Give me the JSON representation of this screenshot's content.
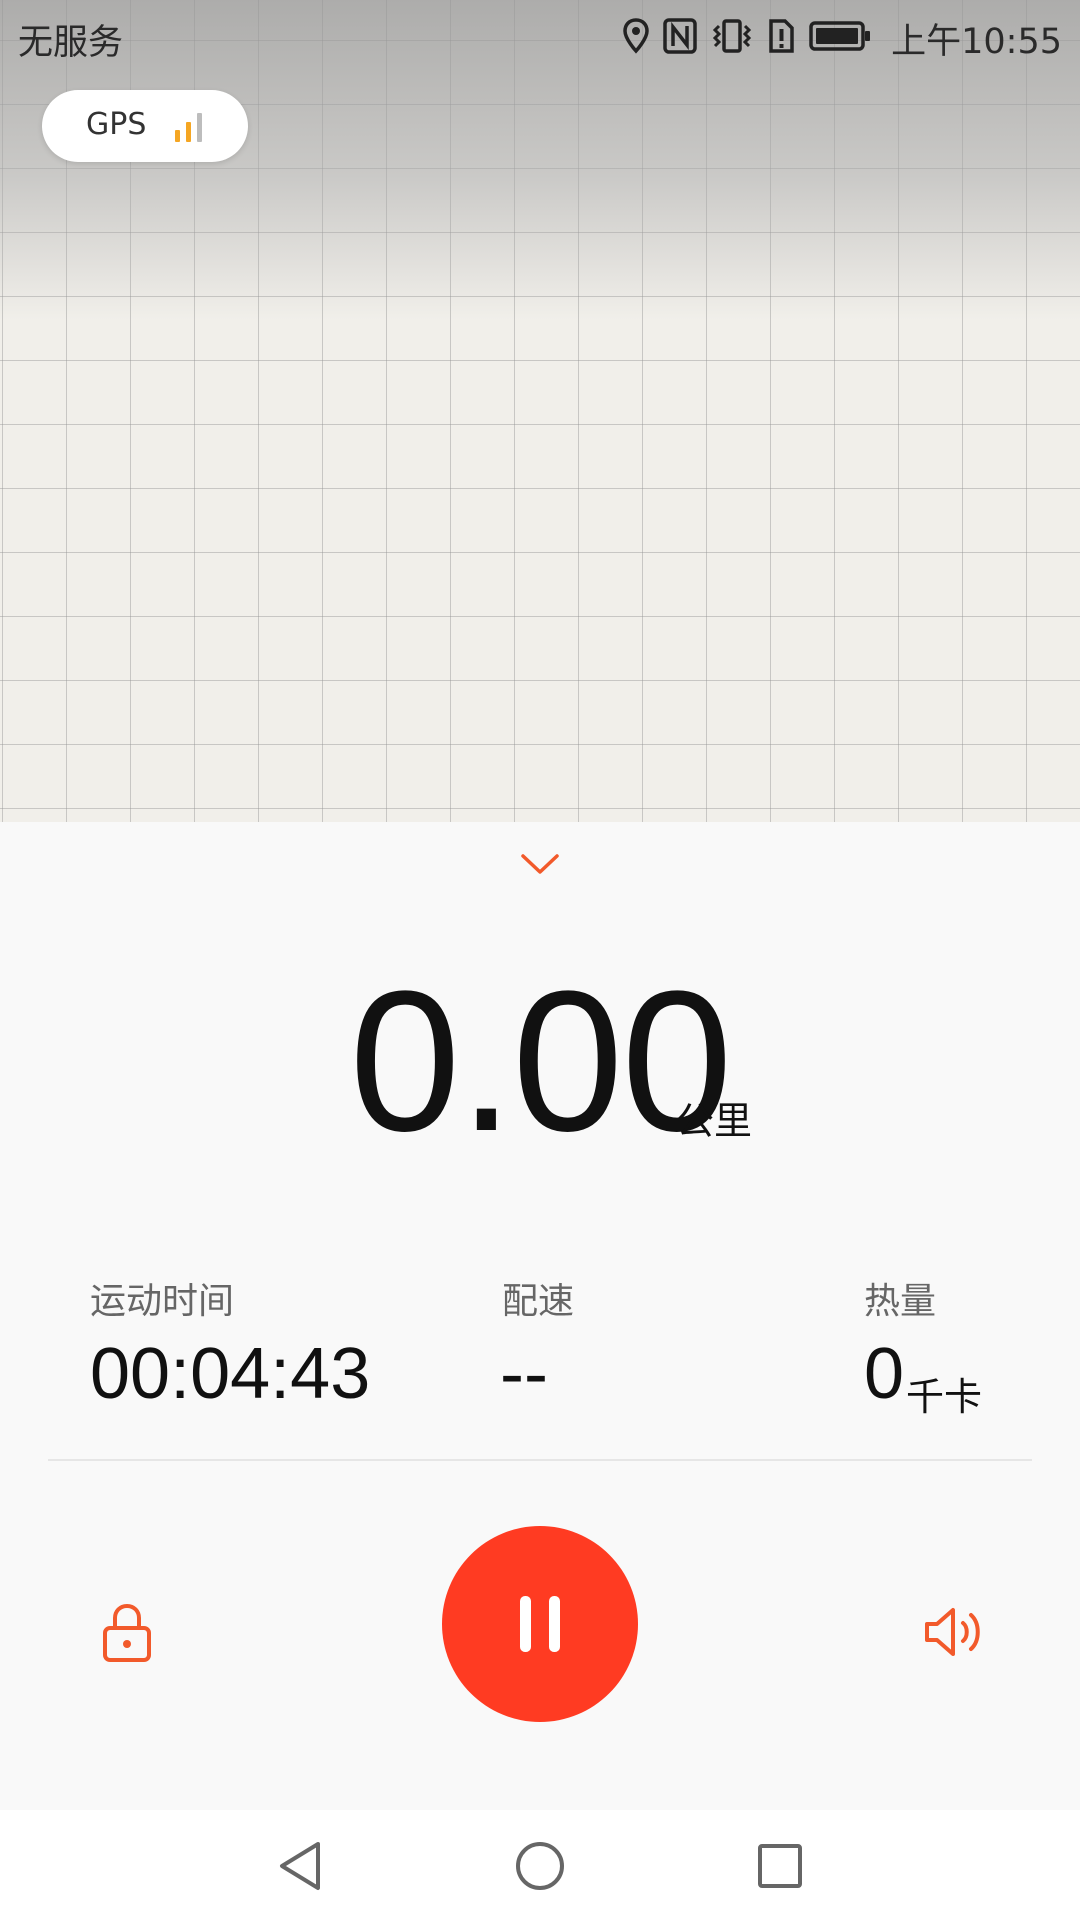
{
  "status_bar": {
    "carrier": "无服务",
    "time": "上午10:55",
    "icons": [
      "location-icon",
      "nfc-icon",
      "vibrate-icon",
      "sim-alert-icon",
      "battery-icon"
    ]
  },
  "gps": {
    "label": "GPS",
    "signal_icon": "signal-bars-icon",
    "signal_level": "2 of 3 bars",
    "signal_color": "#f5a623"
  },
  "workout": {
    "collapse_icon": "chevron-down-icon",
    "distance": {
      "value": "0.00",
      "unit": "公里"
    },
    "stats": [
      {
        "label": "运动时间",
        "value": "00:04:43",
        "unit": ""
      },
      {
        "label": "配速",
        "value": "--",
        "unit": ""
      },
      {
        "label": "热量",
        "value": "0",
        "unit": "千卡"
      }
    ]
  },
  "controls": {
    "lock_icon": "lock-icon",
    "pause_icon": "pause-icon",
    "sound_icon": "speaker-icon"
  },
  "nav": {
    "back_icon": "back-triangle-icon",
    "home_icon": "home-circle-icon",
    "recents_icon": "recents-square-icon"
  },
  "colors": {
    "accent": "#f25a2b",
    "pause_button": "#ff3b22",
    "map_background": "#f1efea"
  }
}
